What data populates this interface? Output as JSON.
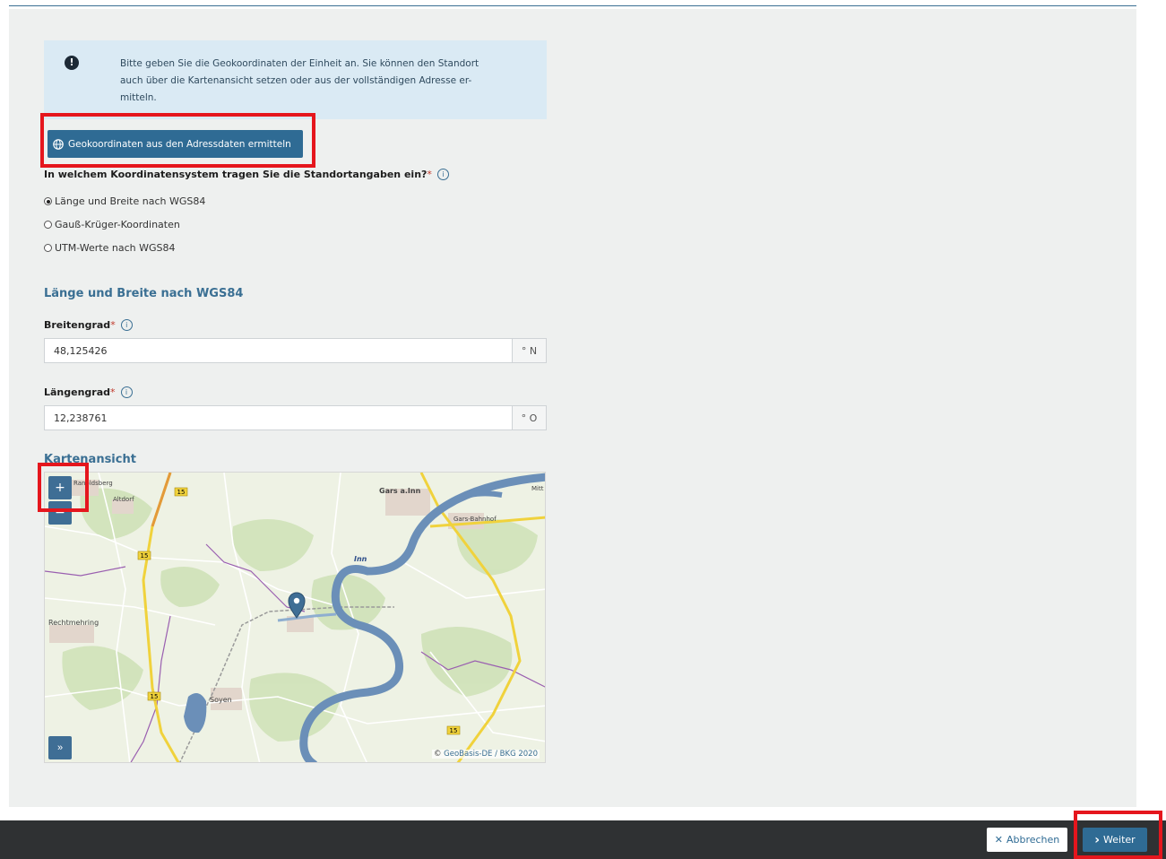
{
  "info_box": {
    "text": "Bitte geben Sie die Geokoordinaten der Einheit an. Sie können den Standort auch über die Kartenansicht setzen oder aus der vollständigen Adresse er-mitteln.",
    "icon": "exclamation-circle-icon"
  },
  "geo_button": {
    "label": "Geokoordinaten aus den Adressdaten ermitteln",
    "icon": "globe-icon"
  },
  "coordinate_question": {
    "label": "In welchem Koordinatensystem tragen Sie die Standortangaben ein?",
    "required_mark": "*",
    "options": [
      {
        "label": "Länge und Breite nach WGS84",
        "checked": true
      },
      {
        "label": "Gauß-Krüger-Koordinaten",
        "checked": false
      },
      {
        "label": "UTM-Werte nach WGS84",
        "checked": false
      }
    ]
  },
  "section": {
    "title": "Länge und Breite nach WGS84"
  },
  "latitude": {
    "label": "Breitengrad",
    "required_mark": "*",
    "value": "48,125426",
    "unit": "° N"
  },
  "longitude": {
    "label": "Längengrad",
    "required_mark": "*",
    "value": "12,238761",
    "unit": "° O"
  },
  "map": {
    "title": "Kartenansicht",
    "zoom_in": "+",
    "zoom_out": "−",
    "expand": "»",
    "places": [
      "Ranoldsberg",
      "Altdorf",
      "Gars a.Inn",
      "Gars-Bahnhof",
      "Mitt",
      "Inn",
      "Rechtmehring",
      "Soyen"
    ],
    "road_shields": [
      "15",
      "15",
      "15",
      "15"
    ],
    "attribution_symbol": "©",
    "attribution_link": "GeoBasis-DE / BKG 2020",
    "highlight_color": "#e5161d",
    "river_color": "#6b8fb8",
    "marker_color": "#3f6e95"
  },
  "footer": {
    "cancel_label": "Abbrechen",
    "cancel_icon": "✕",
    "next_label": "Weiter",
    "next_icon": "›"
  }
}
